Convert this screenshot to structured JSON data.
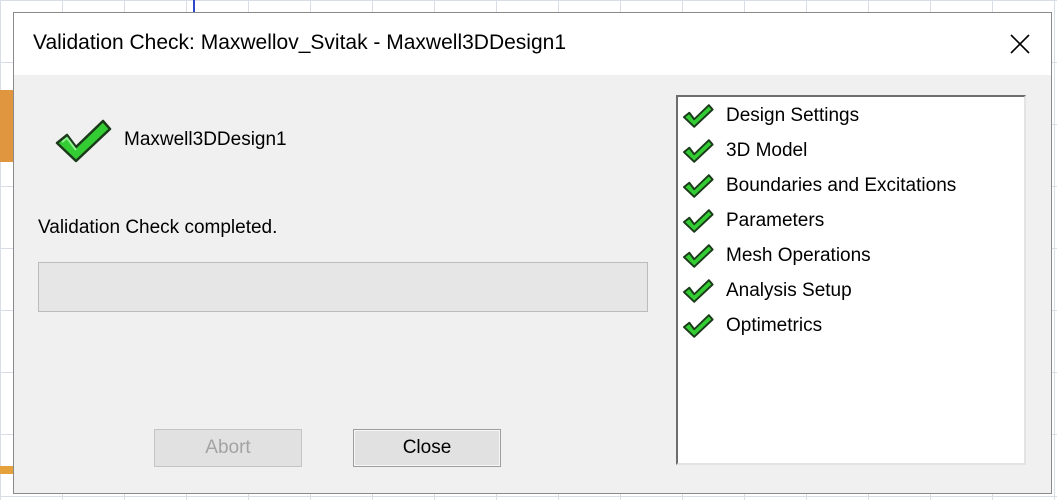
{
  "window": {
    "title": "Validation Check: Maxwellov_Svitak - Maxwell3DDesign1"
  },
  "status": {
    "icon": "green-check-icon",
    "design_name": "Maxwell3DDesign1",
    "message": "Validation Check completed.",
    "progress_percent": 0
  },
  "buttons": {
    "abort_label": "Abort",
    "close_label": "Close"
  },
  "checklist": [
    {
      "label": "Design Settings",
      "icon": "green-check-icon"
    },
    {
      "label": "3D Model",
      "icon": "green-check-icon"
    },
    {
      "label": "Boundaries and Excitations",
      "icon": "green-check-icon"
    },
    {
      "label": "Parameters",
      "icon": "green-check-icon"
    },
    {
      "label": "Mesh Operations",
      "icon": "green-check-icon"
    },
    {
      "label": "Analysis Setup",
      "icon": "green-check-icon"
    },
    {
      "label": "Optimetrics",
      "icon": "green-check-icon"
    }
  ],
  "colors": {
    "check_green": "#33cc33",
    "check_outline": "#1a3a1a",
    "dialog_bg": "#f0f0f0"
  }
}
